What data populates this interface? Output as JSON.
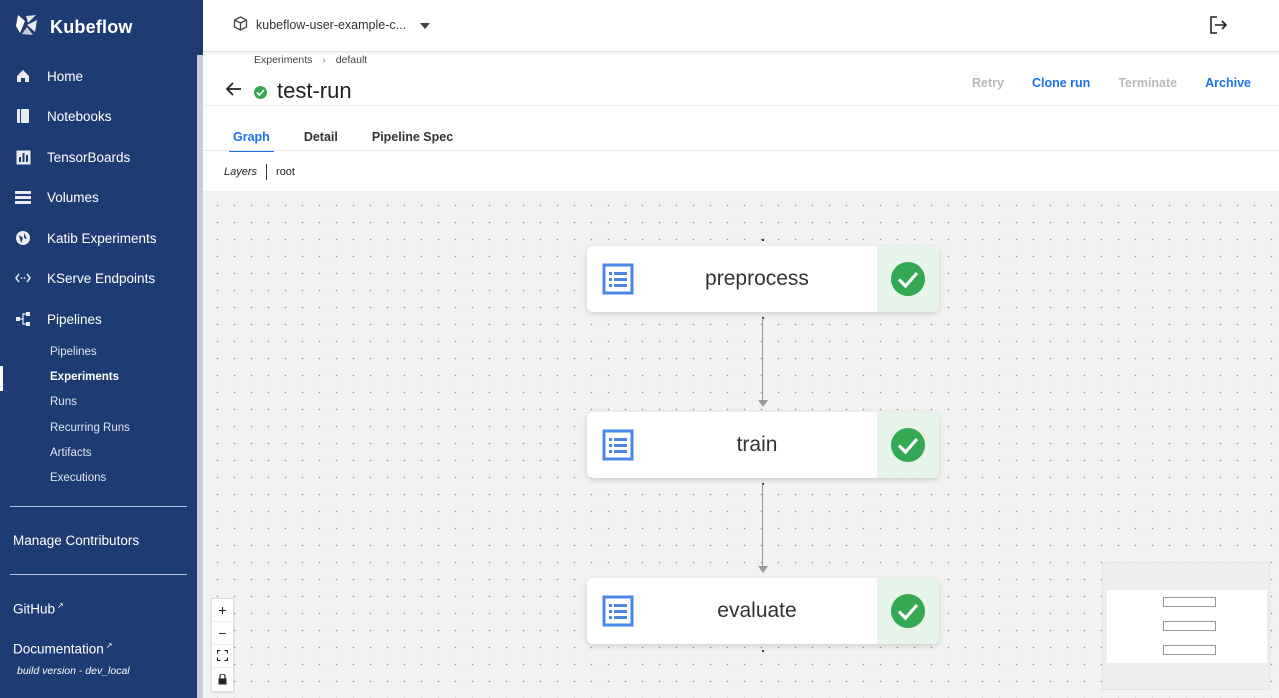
{
  "app": {
    "name": "Kubeflow"
  },
  "sidebar": {
    "items": [
      {
        "label": "Home",
        "icon": "home-icon"
      },
      {
        "label": "Notebooks",
        "icon": "notebook-icon"
      },
      {
        "label": "TensorBoards",
        "icon": "chart-icon"
      },
      {
        "label": "Volumes",
        "icon": "storage-icon"
      },
      {
        "label": "Katib Experiments",
        "icon": "katib-icon"
      },
      {
        "label": "KServe Endpoints",
        "icon": "code-icon"
      },
      {
        "label": "Pipelines",
        "icon": "pipeline-icon"
      }
    ],
    "sub_items": [
      "Pipelines",
      "Experiments",
      "Runs",
      "Recurring Runs",
      "Artifacts",
      "Executions"
    ],
    "active_sub": "Experiments",
    "manage_contributors": "Manage Contributors",
    "github": "GitHub",
    "documentation": "Documentation",
    "build_version": "build version - dev_local"
  },
  "topbar": {
    "namespace": "kubeflow-user-example-c..."
  },
  "breadcrumb": [
    "Experiments",
    "default"
  ],
  "run": {
    "title": "test-run",
    "status": "succeeded"
  },
  "actions": [
    {
      "label": "Retry",
      "enabled": false
    },
    {
      "label": "Clone run",
      "enabled": true
    },
    {
      "label": "Terminate",
      "enabled": false
    },
    {
      "label": "Archive",
      "enabled": true
    }
  ],
  "tabs": [
    "Graph",
    "Detail",
    "Pipeline Spec"
  ],
  "active_tab": "Graph",
  "layers": {
    "label": "Layers",
    "current": "root"
  },
  "graph": {
    "nodes": [
      {
        "label": "preprocess",
        "status": "succeeded"
      },
      {
        "label": "train",
        "status": "succeeded"
      },
      {
        "label": "evaluate",
        "status": "succeeded"
      }
    ]
  },
  "colors": {
    "sidebar": "#1f3b73",
    "accent": "#1a73e8",
    "success": "#34a853",
    "success_bg": "#e6f4ea",
    "node_icon": "#4a86e8"
  }
}
